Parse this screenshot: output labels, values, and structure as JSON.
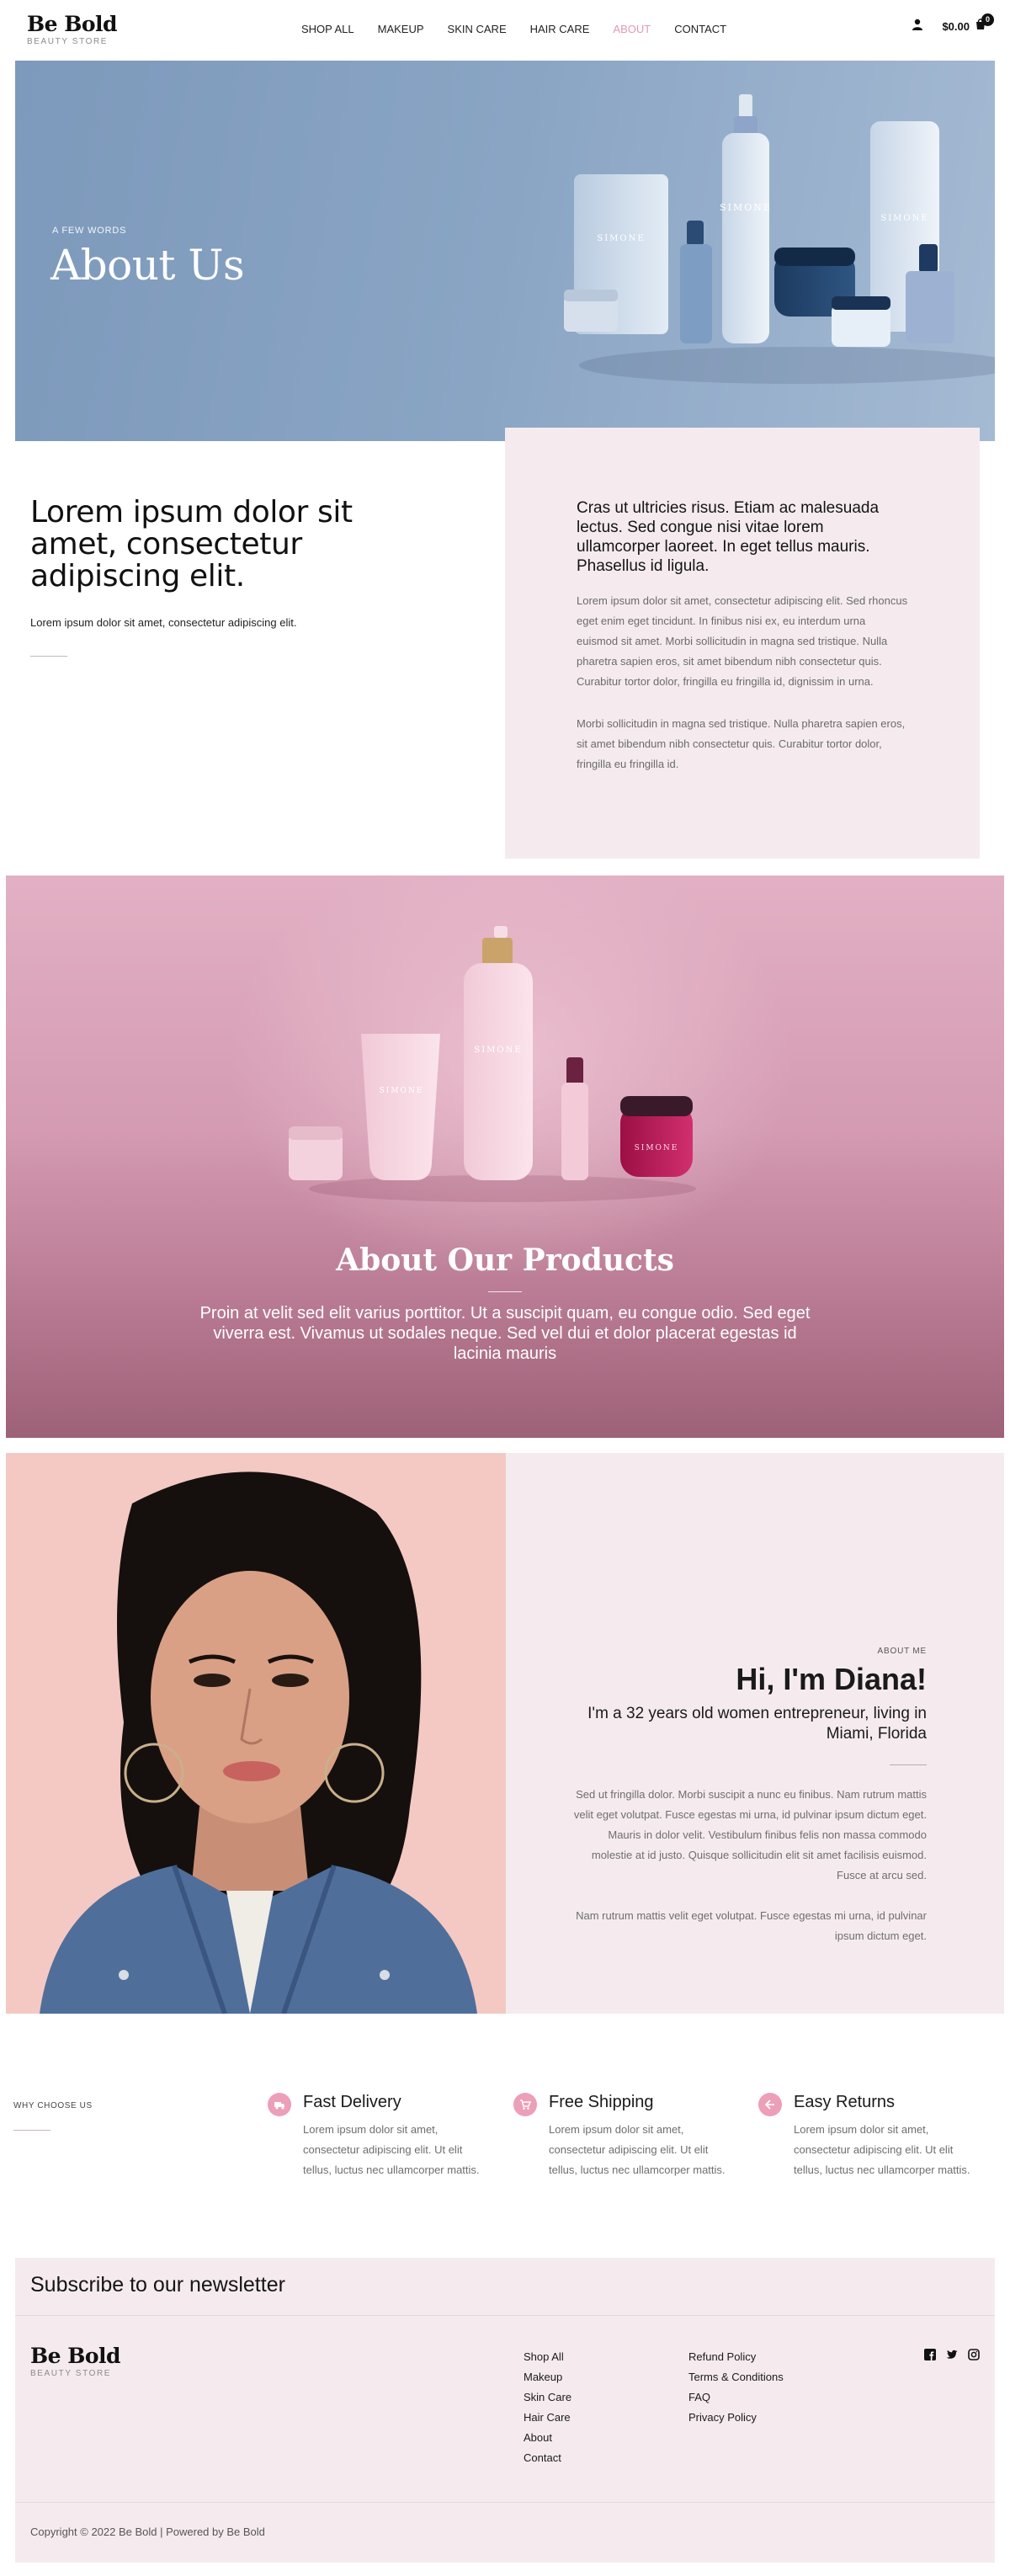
{
  "header": {
    "logo": "Be Bold",
    "logo_sub": "BEAUTY STORE",
    "nav": [
      {
        "label": "SHOP ALL"
      },
      {
        "label": "MAKEUP"
      },
      {
        "label": "SKIN CARE"
      },
      {
        "label": "HAIR CARE"
      },
      {
        "label": "ABOUT",
        "active": true
      },
      {
        "label": "CONTACT"
      }
    ],
    "cart_total": "$0.00",
    "cart_count": "0"
  },
  "hero": {
    "eyebrow": "A FEW WORDS",
    "title": "About Us",
    "product_brand": "SIMONE"
  },
  "intro": {
    "heading": "Lorem ipsum dolor sit amet, consectetur adipiscing elit.",
    "subtext": "Lorem ipsum dolor sit amet, consectetur adipiscing elit.",
    "card_lead": "Cras ut ultricies risus. Etiam ac malesuada lectus. Sed congue nisi vitae lorem ullamcorper laoreet. In eget tellus mauris. Phasellus id ligula.",
    "card_p1": "Lorem ipsum dolor sit amet, consectetur adipiscing elit. Sed rhoncus eget enim eget tincidunt. In finibus nisi ex, eu interdum urna euismod sit amet. Morbi sollicitudin in magna sed tristique. Nulla pharetra sapien eros, sit amet bibendum nibh consectetur quis. Curabitur tortor dolor, fringilla eu fringilla id, dignissim in urna.",
    "card_p2": "Morbi sollicitudin in magna sed tristique. Nulla pharetra sapien eros, sit amet bibendum nibh consectetur quis. Curabitur tortor dolor, fringilla eu fringilla id."
  },
  "products": {
    "title": "About Our Products",
    "text": "Proin at velit sed elit varius porttitor. Ut a suscipit quam, eu congue odio. Sed eget viverra est. Vivamus ut sodales neque. Sed vel dui et dolor placerat egestas id lacinia mauris"
  },
  "about_me": {
    "eyebrow": "ABOUT ME",
    "title": "Hi, I'm Diana!",
    "subtitle": "I'm a 32 years old women entrepreneur, living in Miami, Florida",
    "p1": "Sed ut fringilla dolor. Morbi suscipit a nunc eu finibus. Nam rutrum mattis velit eget volutpat. Fusce egestas mi urna, id pulvinar ipsum dictum eget. Mauris in dolor velit. Vestibulum finibus felis non massa commodo molestie at id justo. Quisque sollicitudin elit sit amet facilisis euismod. Fusce at arcu sed.",
    "p2": "Nam rutrum mattis velit eget volutpat. Fusce egestas mi urna, id pulvinar ipsum dictum eget."
  },
  "why": {
    "label": "WHY CHOOSE US",
    "features": [
      {
        "title": "Fast Delivery",
        "text": "Lorem ipsum dolor sit amet, consectetur adipiscing elit. Ut elit tellus, luctus nec ullamcorper mattis.",
        "icon": "delivery-icon"
      },
      {
        "title": "Free Shipping",
        "text": "Lorem ipsum dolor sit amet, consectetur adipiscing elit. Ut elit tellus, luctus nec ullamcorper mattis.",
        "icon": "cart-icon"
      },
      {
        "title": "Easy Returns",
        "text": "Lorem ipsum dolor sit amet, consectetur adipiscing elit. Ut elit tellus, luctus nec ullamcorper mattis.",
        "icon": "return-icon"
      }
    ]
  },
  "footer": {
    "newsletter": "Subscribe to our newsletter",
    "logo": "Be Bold",
    "logo_sub": "BEAUTY STORE",
    "col1": [
      "Shop All",
      "Makeup",
      "Skin Care",
      "Hair Care",
      "About",
      "Contact"
    ],
    "col2": [
      "Refund Policy",
      "Terms & Conditions",
      "FAQ",
      "Privacy Policy"
    ],
    "socials": [
      "facebook-icon",
      "twitter-icon",
      "instagram-icon"
    ],
    "copyright": "Copyright © 2022 Be Bold | Powered by Be Bold"
  },
  "colors": {
    "accent": "#e39ab1",
    "card_bg": "#f5ebef",
    "hero_bg": "#8aa5c4",
    "products_bg": "#d49bb2"
  }
}
